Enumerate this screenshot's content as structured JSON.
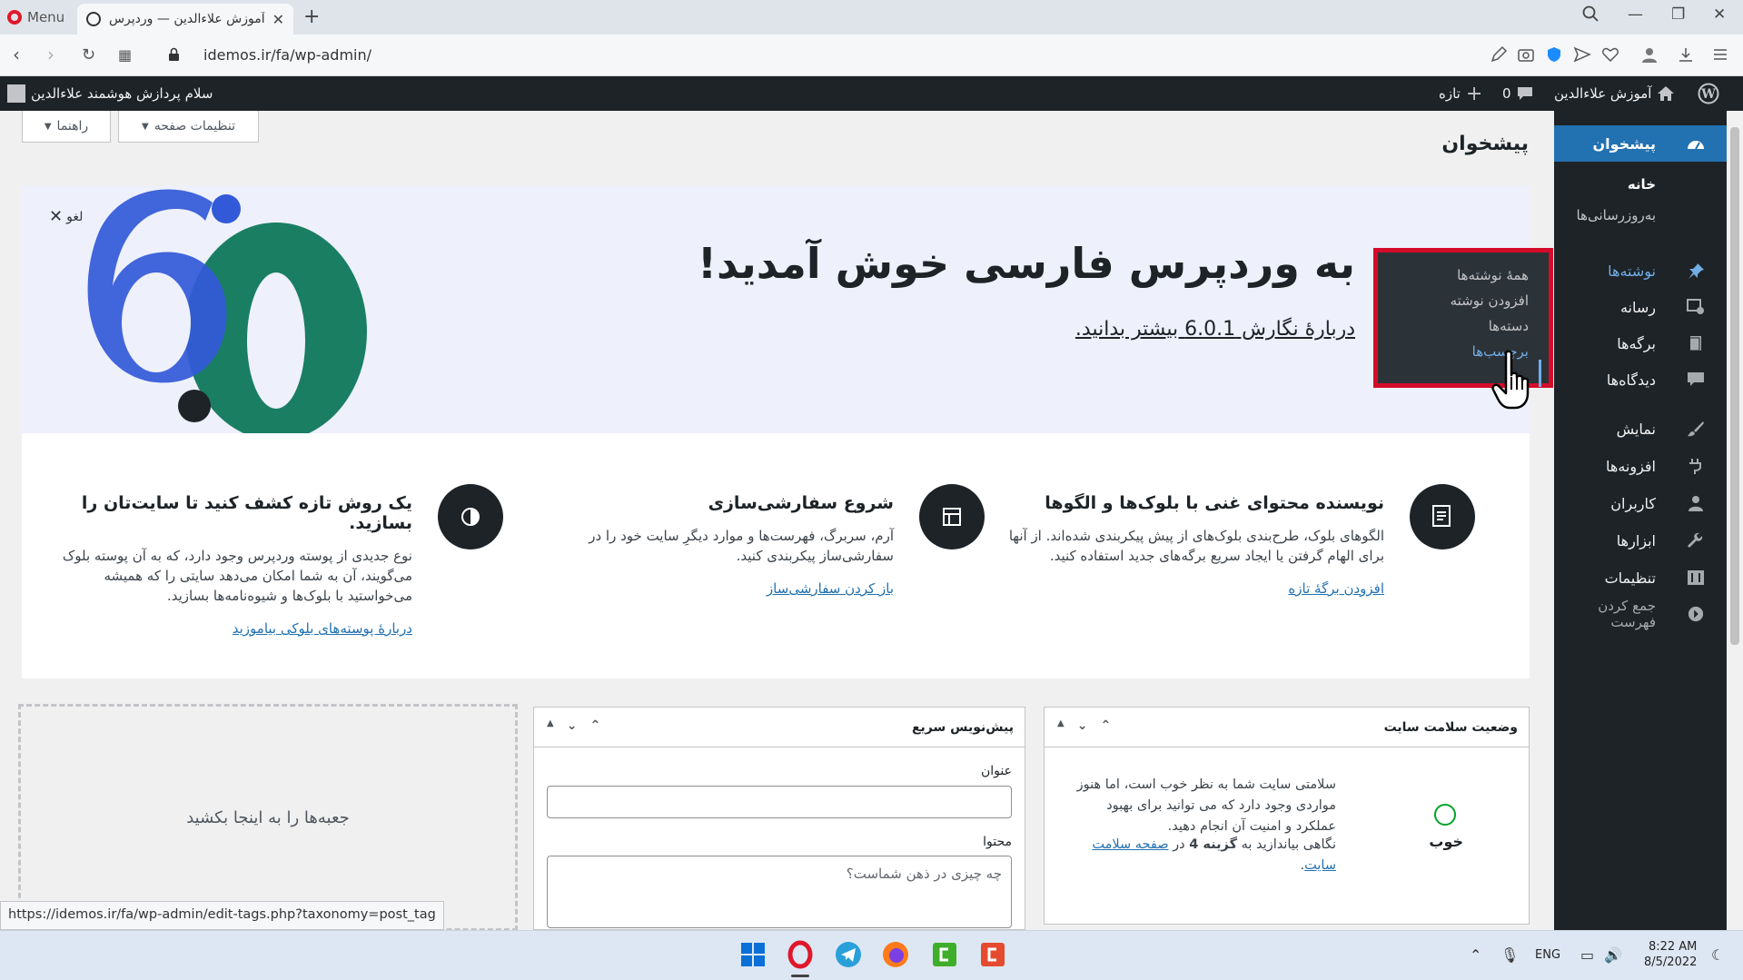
{
  "browser": {
    "menu_label": "Menu",
    "tab_title": "آموزش علاءالدین — وردپرس",
    "url": "idemos.ir/fa/wp-admin/",
    "status_url": "https://idemos.ir/fa/wp-admin/edit-tags.php?taxonomy=post_tag"
  },
  "adminbar": {
    "site_name": "آموزش علاءالدین",
    "comments_count": "0",
    "new_label": "تازه",
    "greeting": "سلام پردازش هوشمند علاءالدین"
  },
  "sidebar": {
    "dashboard": "پیشخوان",
    "home": "خانه",
    "updates": "به‌روزرسانی‌ها",
    "posts": "نوشته‌ها",
    "media": "رسانه",
    "pages": "برگه‌ها",
    "comments": "دیدگاه‌ها",
    "appearance": "نمایش",
    "plugins": "افزونه‌ها",
    "users": "کاربران",
    "tools": "ابزارها",
    "settings": "تنظیمات",
    "collapse": "جمع کردن فهرست"
  },
  "flyout": {
    "all_posts": "همهٔ نوشته‌ها",
    "add_post": "افزودن نوشته",
    "categories": "دسته‌ها",
    "tags": "برچسب‌ها"
  },
  "header": {
    "screen_options": "تنظیمات صفحه",
    "help": "راهنما",
    "page_title": "پیشخوان"
  },
  "welcome": {
    "heading": "به وردپرس فارسی خوش آمدید!",
    "link": "دربارهٔ نگارش 6.0.1 بیشتر بدانید.",
    "dismiss": "لغو",
    "version_art": "6.0",
    "columns": [
      {
        "title": "نویسنده محتوای غنی با بلوک‌ها و الگوها",
        "text": "الگوهای بلوک، طرح‌بندی بلوک‌های از پیش پیکربندی شده‌اند. از آنها برای الهام گرفتن یا ایجاد سریع برگه‌های جدید استفاده کنید.",
        "link": "افزودن برگهٔ تازه",
        "icon": "document-icon"
      },
      {
        "title": "شروع سفارشی‌سازی",
        "text": "آرم، سربرگ، فهرست‌ها و موارد دیگرِ سایت خود را در سفارشی‌ساز پیکربندی کنید.",
        "link": "باز کردن سفارشی‌ساز",
        "icon": "layout-icon"
      },
      {
        "title": "یک روش تازه کشف کنید تا سایت‌تان را بسازید.",
        "text": "نوع جدیدی از پوسته وردپرس وجود دارد، که به آن پوسته بلوک می‌گویند، آن به شما امکان می‌دهد سایتی را که همیشه می‌خواستید با بلوک‌ها و شیوه‌نامه‌ها بسازید.",
        "link": "دربارهٔ پوسته‌های بلوکی بیاموزید",
        "icon": "contrast-icon"
      }
    ]
  },
  "site_health": {
    "title": "وضعیت سلامت سایت",
    "status": "خوب",
    "text": "سلامتی سایت شما به نظر خوب است، اما هنوز مواردی وجود دارد که می توانید برای بهبود عملکرد و امنیت آن انجام دهید.",
    "text2_prefix": "نگاهی بیاندازید به",
    "text2_bold": "گزینه 4",
    "text2_mid": "در",
    "text2_link": "صفحه سلامت سایت",
    "text2_suffix": "."
  },
  "quick_draft": {
    "title": "پیش‌نویس سریع",
    "title_label": "عنوان",
    "content_label": "محتوا",
    "content_placeholder": "چه چیزی در ذهن شماست؟"
  },
  "dropzone": {
    "label": "جعبه‌ها را به اینجا بکشید"
  },
  "taskbar": {
    "lang": "ENG",
    "time": "8:22 AM",
    "date": "8/5/2022"
  }
}
